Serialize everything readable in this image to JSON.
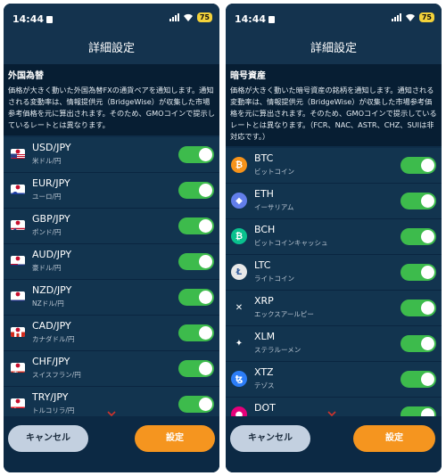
{
  "status": {
    "time": "14:44",
    "battery": "75"
  },
  "left": {
    "title": "詳細設定",
    "section_heading": "外国為替",
    "description": "価格が大きく動いた外国為替FXの通貨ペアを通知します。通知される変動率は、情報提供元（BridgeWise）が収集した市場参考価格を元に算出されます。そのため、GMOコインで提示しているレートとは異なります。",
    "items": [
      {
        "symbol": "USD/JPY",
        "name": "米ドル/円",
        "flag": "us",
        "enabled": true
      },
      {
        "symbol": "EUR/JPY",
        "name": "ユーロ/円",
        "flag": "eu",
        "enabled": true
      },
      {
        "symbol": "GBP/JPY",
        "name": "ポンド/円",
        "flag": "gb",
        "enabled": true
      },
      {
        "symbol": "AUD/JPY",
        "name": "豪ドル/円",
        "flag": "au",
        "enabled": true
      },
      {
        "symbol": "NZD/JPY",
        "name": "NZドル/円",
        "flag": "nz",
        "enabled": true
      },
      {
        "symbol": "CAD/JPY",
        "name": "カナダドル/円",
        "flag": "ca",
        "enabled": true
      },
      {
        "symbol": "CHF/JPY",
        "name": "スイスフラン/円",
        "flag": "ch",
        "enabled": true
      },
      {
        "symbol": "TRY/JPY",
        "name": "トルコリラ/円",
        "flag": "tr",
        "enabled": true
      }
    ],
    "cancel_label": "キャンセル",
    "ok_label": "設定"
  },
  "right": {
    "title": "詳細設定",
    "section_heading": "暗号資産",
    "description": "価格が大きく動いた暗号資産の銘柄を通知します。通知される変動率は、情報提供元（BridgeWise）が収集した市場参考価格を元に算出されます。そのため、GMOコインで提示しているレートとは異なります。（FCR、NAC、ASTR、CHZ、SUIは非対応です。）",
    "items": [
      {
        "symbol": "BTC",
        "name": "ビットコイン",
        "icon": "btc-icon",
        "color": "#f7931a",
        "glyph": "₿",
        "enabled": true
      },
      {
        "symbol": "ETH",
        "name": "イーサリアム",
        "icon": "eth-icon",
        "color": "#627eea",
        "glyph": "◆",
        "enabled": true
      },
      {
        "symbol": "BCH",
        "name": "ビットコインキャッシュ",
        "icon": "bch-icon",
        "color": "#0ac18e",
        "glyph": "₿",
        "enabled": true
      },
      {
        "symbol": "LTC",
        "name": "ライトコイン",
        "icon": "ltc-icon",
        "color": "#e8e8e8",
        "glyph": "Ł",
        "enabled": true
      },
      {
        "symbol": "XRP",
        "name": "エックスアールピー",
        "icon": "xrp-icon",
        "color": "#12344f",
        "glyph": "✕",
        "enabled": true
      },
      {
        "symbol": "XLM",
        "name": "ステラルーメン",
        "icon": "xlm-icon",
        "color": "#12344f",
        "glyph": "✦",
        "enabled": true
      },
      {
        "symbol": "XTZ",
        "name": "テゾス",
        "icon": "xtz-icon",
        "color": "#2c7df7",
        "glyph": "ꜩ",
        "enabled": true
      },
      {
        "symbol": "DOT",
        "name": "ポルカドット",
        "icon": "dot-icon",
        "color": "#e6007a",
        "glyph": "●",
        "enabled": true
      }
    ],
    "cancel_label": "キャンセル",
    "ok_label": "設定"
  },
  "colors": {
    "toggle_on": "#3dbb4c",
    "accent_orange": "#f5951f",
    "panel_bg": "#0e2d49"
  }
}
